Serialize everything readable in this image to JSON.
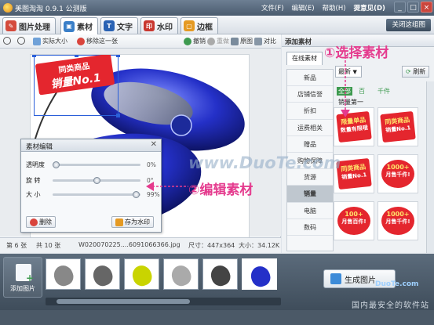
{
  "title_bar": {
    "app_name": "美图淘淘",
    "version": "0.9.1 公测版"
  },
  "menu": [
    "文件(F)",
    "编辑(E)",
    "帮助(H)",
    "提意见(D)"
  ],
  "main_tabs": [
    {
      "label": "图片处理"
    },
    {
      "label": "素材"
    },
    {
      "label": "文字"
    },
    {
      "label": "水印"
    },
    {
      "label": "边框"
    }
  ],
  "close_collage_label": "关闭这组图",
  "edit_toolbar": {
    "actual_size": "实际大小",
    "remove_one": "移除这一张",
    "undo": "撤销",
    "redo": "重做",
    "original": "原图",
    "compare": "对比"
  },
  "photo": {
    "badge_line1": "同类商品",
    "badge_line2": "销量No.1"
  },
  "material_dialog": {
    "title": "素材编辑",
    "sliders": [
      {
        "label": "透明度",
        "value_text": "0%",
        "level": 0.0
      },
      {
        "label": "旋 转",
        "value_text": "0°",
        "level": 0.5
      },
      {
        "label": "大 小",
        "value_text": "99%",
        "level": 0.99
      }
    ],
    "delete_label": "删除",
    "save_watermark_label": "存为水印"
  },
  "status": {
    "page": "第 6 张",
    "total": "共 10 张",
    "filename": "W020070225....6091066366.jpg",
    "dims": "尺寸：447x364",
    "size": "大小：34.12K"
  },
  "right_panel": {
    "title": "添加素材",
    "online_tab": "在线素材",
    "sort_value": "最新",
    "refresh_label": "刷新",
    "price_tabs": [
      "全部",
      "百",
      "千件"
    ],
    "category_label": "销量第一",
    "categories": [
      "新品",
      "店铺信誉",
      "折扣",
      "运费相关",
      "赠品",
      "购物保障",
      "货源",
      "销量",
      "电脑",
      "数码"
    ],
    "active_category": "销量",
    "stickers": [
      {
        "top": "限量单品",
        "bottom": "数量有限哦"
      },
      {
        "top": "同类商品",
        "bottom": "销量No.1"
      },
      {
        "top": "同类商品",
        "bottom": "销量No.1"
      },
      {
        "top": "1000+",
        "bottom": "月售千件!"
      },
      {
        "top": "100+",
        "bottom": "月售百件!"
      },
      {
        "top": "1000+",
        "bottom": "月售千件!"
      }
    ]
  },
  "filmstrip": {
    "add_label": "添加图片",
    "generate_label": "生成图片"
  },
  "annotations": {
    "step1": "①选择素材",
    "step2": "②编辑素材"
  },
  "watermarks": {
    "center": "www.DuoTe.com",
    "corner": "DuoTe.com",
    "footer": "国内最安全的软件站"
  },
  "colors": {
    "accent": "#e53b8e",
    "title_bar": "#4a5b6e",
    "badge_red": "#e4262e"
  }
}
